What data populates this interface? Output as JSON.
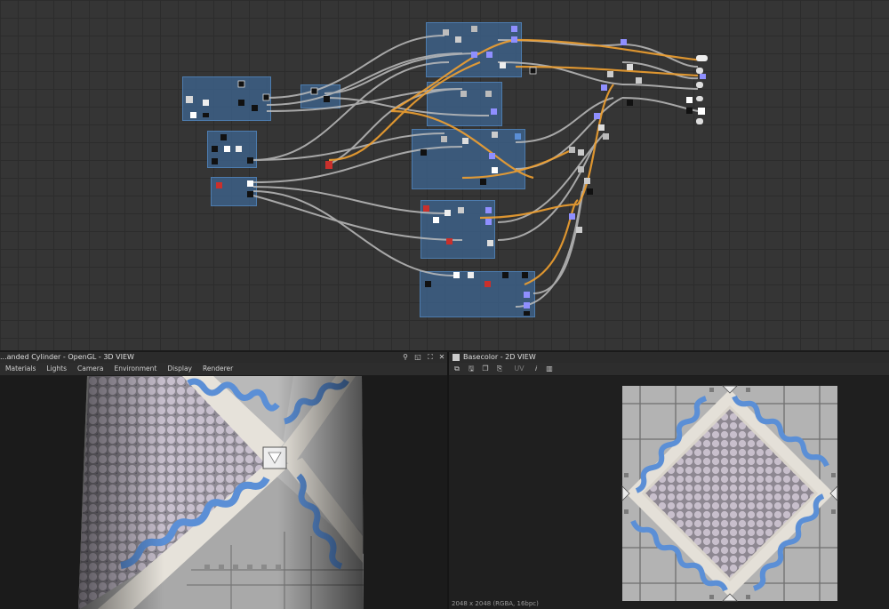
{
  "panels": {
    "view3d": {
      "title": "...anded Cylinder - OpenGL - 3D VIEW",
      "menu": [
        "Materials",
        "Lights",
        "Camera",
        "Environment",
        "Display",
        "Renderer"
      ]
    },
    "view2d": {
      "title": "Basecolor - 2D VIEW",
      "uv_label": "UV",
      "status": "2048 x 2048 (RGBA, 16bpc)"
    }
  },
  "colors": {
    "graph_bg": "#353535",
    "frame": "#3e6896",
    "wire_gray": "#bdbdbd",
    "wire_orange": "#f0a030",
    "tile_blue": "#5b8fd6",
    "mosaic_lilac": "#b8acc0",
    "marble": "#b9b9b9"
  }
}
